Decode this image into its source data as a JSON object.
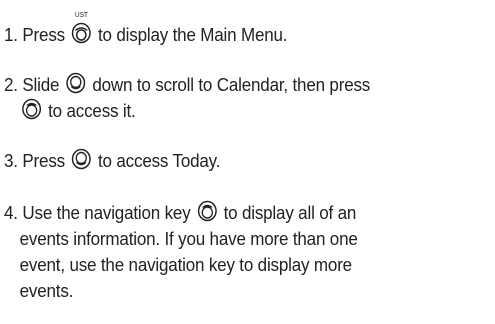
{
  "steps": [
    {
      "number": "1.",
      "lines": [
        {
          "before": "Press",
          "icon": "ok-key-icon",
          "icon_label": "UST",
          "after": "to display the Main Menu."
        }
      ]
    },
    {
      "number": "2.",
      "lines": [
        {
          "before": "Slide",
          "icon": "nav-key-down-icon",
          "after": "down to scroll to Calendar, then press"
        },
        {
          "before": "",
          "icon": "nav-key-up-icon",
          "after": "to access it."
        }
      ]
    },
    {
      "number": "3.",
      "lines": [
        {
          "before": "Press",
          "icon": "nav-key-down-icon",
          "after": "to access Today."
        }
      ]
    },
    {
      "number": "4.",
      "lines": [
        {
          "before": "Use the navigation key",
          "icon": "nav-key-up-icon",
          "after": "to display all of an"
        },
        {
          "text": "events information. If you have more than one"
        },
        {
          "text": "event, use the navigation key to display more"
        },
        {
          "text": "events."
        }
      ]
    }
  ]
}
